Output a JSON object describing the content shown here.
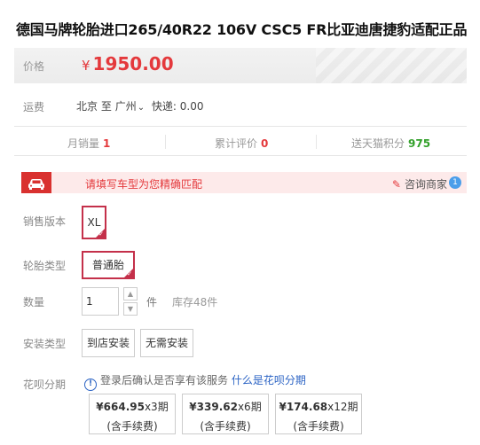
{
  "product": {
    "title": "德国马牌轮胎进口265/40R22 106V CSC5 FR比亚迪唐捷豹适配正品"
  },
  "price": {
    "label": "价格",
    "currency": "¥",
    "value": "1950.00"
  },
  "shipping": {
    "label": "运费",
    "from": "北京",
    "to_word": "至",
    "to": "广州",
    "express": "快递: 0.00"
  },
  "stats": {
    "monthly_sales_label": "月销量",
    "monthly_sales": "1",
    "reviews_label": "累计评价",
    "reviews": "0",
    "points_label": "送天猫积分",
    "points": "975"
  },
  "car_tip": {
    "text": "请填写车型为您精确匹配",
    "consult": "咨询商家",
    "badge": "1"
  },
  "version": {
    "label": "销售版本",
    "option": "XL"
  },
  "tire_type": {
    "label": "轮胎类型",
    "option": "普通胎"
  },
  "quantity": {
    "label": "数量",
    "value": "1",
    "unit": "件",
    "stock": "库存48件"
  },
  "install": {
    "label": "安装类型",
    "options": [
      "到店安装",
      "无需安装"
    ]
  },
  "huabei": {
    "label": "花呗分期",
    "info": "登录后确认是否享有该服务",
    "link": "什么是花呗分期",
    "plans": [
      {
        "amount": "¥664.95",
        "periods": "x3期",
        "fee": "(含手续费)"
      },
      {
        "amount": "¥339.62",
        "periods": "x6期",
        "fee": "(含手续费)"
      },
      {
        "amount": "¥174.68",
        "periods": "x12期",
        "fee": "(含手续费)"
      }
    ]
  },
  "colors": {
    "accent": "#e4393c",
    "selected_border": "#c4304a",
    "link": "#2b63c4",
    "points": "#32a02a"
  }
}
